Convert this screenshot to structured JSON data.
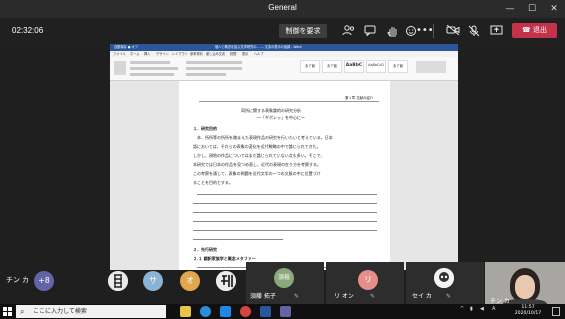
{
  "window": {
    "title": "General"
  },
  "meeting_bar": {
    "timer": "02:32:06",
    "control_label": "制御を要求",
    "leave_label": "退出",
    "icons": [
      "people-icon",
      "chat-icon",
      "hand-icon",
      "reactions-icon",
      "more-icon",
      "camera-icon",
      "mic-off-icon",
      "share-icon"
    ]
  },
  "shared_doc": {
    "window_title": "個人と概念を結ぶ文学研究の...  — 文書の表示の強調 - Word",
    "quick_access": "自動保存 ● オフ",
    "menu": [
      "ファイル",
      "ホーム",
      "挿入",
      "デザイン",
      "レイアウト",
      "参考資料",
      "差し込み文書",
      "校閲",
      "表示",
      "ヘルプ"
    ],
    "styles": [
      "あア亜",
      "あア亜",
      "AaBbC",
      "AaBbCcD",
      "あア亜"
    ],
    "header_right": "第１章 文献の紹介",
    "title": "両所に関する表象論的の研究分析",
    "subtitle": "ー「ギボレッ」を中心にー",
    "sec1": "１．研究目的",
    "paras": [
      "本、所所等の所所を踏まえた表現作品の研究を行いたいと考えている。日本",
      "語においては、それらの表象の変化を近代戦略の中で論じられてきた。",
      "しかし、現地の作品についてはまだ論じられていない点も多い。そこで、",
      "本研究では日本の作品を見つめ直し、近代の表現の在り方を考察する。",
      "この考察を通して、表象の問題を近代文学の一つの文脈の中に位置づけ",
      "ることを目的とする。"
    ],
    "sec2": "２．先行研究",
    "sec2_1": "２.１ 翻訳家族学と概念メタファー"
  },
  "presenter": {
    "name": "チン カ"
  },
  "participants": {
    "overflow": "+8",
    "circles": [
      {
        "initial": "サ",
        "color": "#8bb3d6"
      },
      {
        "initial": "オ",
        "color": "#e2a64f"
      },
      {
        "initial": "リ",
        "color": "#e68f8a"
      }
    ],
    "tiles": [
      {
        "name": "須藤 拓子",
        "initial": "須裕",
        "color": "#8aa879"
      },
      {
        "name": "リ オン",
        "initial": "",
        "color": ""
      },
      {
        "name": "セイ カ",
        "initial": "",
        "color": ""
      }
    ],
    "camera_name": "チン カ"
  },
  "taskbar": {
    "search_placeholder": "ここに入力して検索",
    "time": "11:57",
    "date": "2020/10/17"
  }
}
